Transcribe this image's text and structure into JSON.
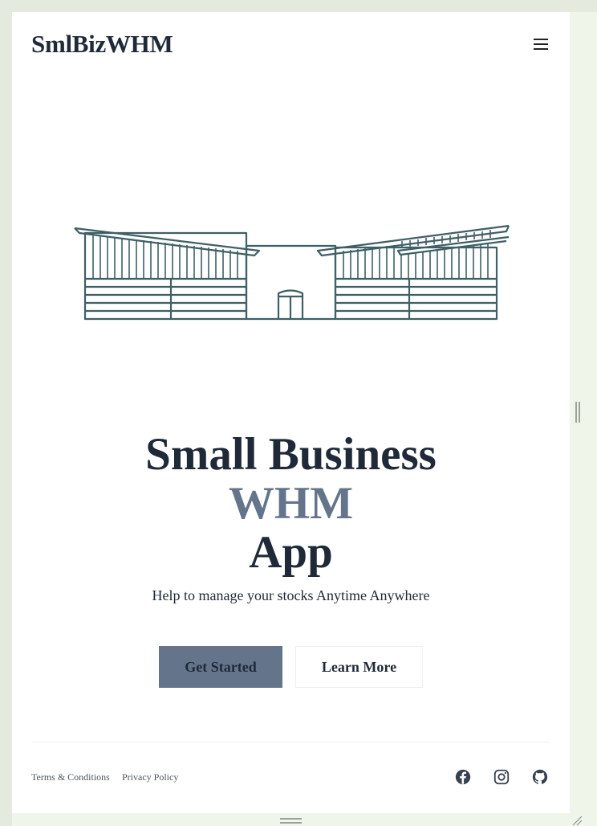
{
  "header": {
    "brand": "SmlBizWHM"
  },
  "hero": {
    "title_line1": "Small Business",
    "title_accent": "WHM",
    "title_line3": "App",
    "subtitle": "Help to manage your stocks Anytime Anywhere",
    "primary_button": "Get Started",
    "secondary_button": "Learn More"
  },
  "footer": {
    "links": [
      "Terms & Conditions",
      "Privacy Policy"
    ],
    "social": [
      "facebook-icon",
      "instagram-icon",
      "github-icon"
    ]
  },
  "colors": {
    "page_bg": "#ffffff",
    "text": "#1f2937",
    "accent": "#64748b",
    "illustration_stroke": "#3f5f66"
  }
}
